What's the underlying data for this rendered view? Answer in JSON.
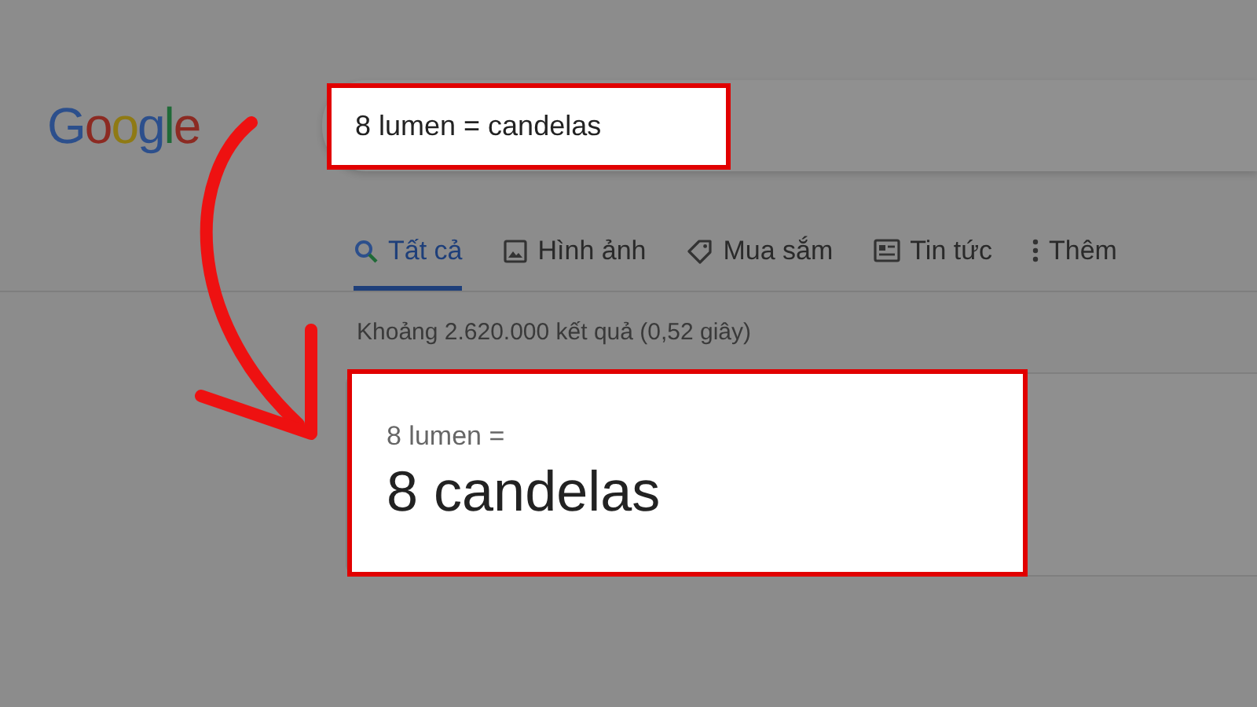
{
  "logo": "Google",
  "search": {
    "value": "8 lumen = candelas"
  },
  "tabs": [
    {
      "label": "Tất cả",
      "kind": "search",
      "selected": true
    },
    {
      "label": "Hình ảnh",
      "kind": "image",
      "selected": false
    },
    {
      "label": "Mua sắm",
      "kind": "tag",
      "selected": false
    },
    {
      "label": "Tin tức",
      "kind": "news",
      "selected": false
    },
    {
      "label": "Thêm",
      "kind": "more",
      "selected": false
    }
  ],
  "result_stats": "Khoảng 2.620.000 kết quả (0,52 giây)",
  "answer": {
    "query": "8 lumen =",
    "result": "8 candelas"
  }
}
